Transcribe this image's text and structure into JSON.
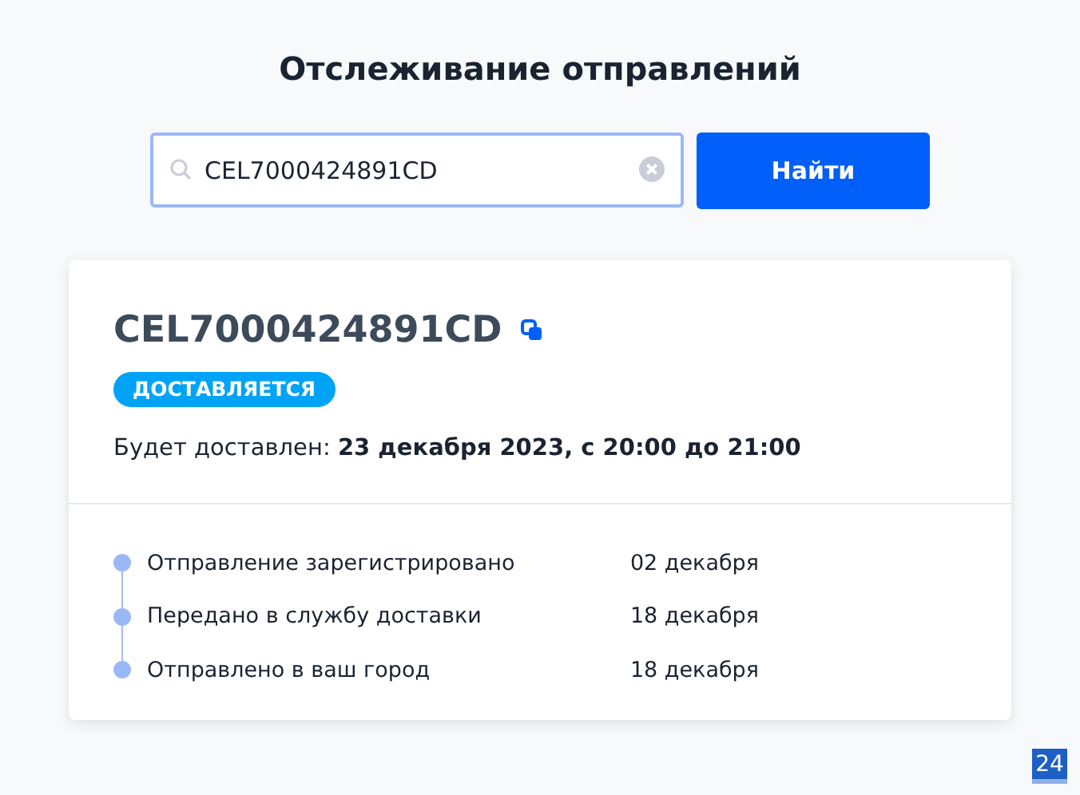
{
  "title": "Отслеживание отправлений",
  "search": {
    "value": "CEL7000424891CD"
  },
  "search_button": "Найти",
  "shipment": {
    "track_number": "CEL7000424891CD",
    "status": "ДОСТАВЛЯЕТСЯ",
    "delivery": "Будет доставлен: **23 декабря 2023, с 20:00 до 21:00**",
    "events": [
      {
        "label": "Отправление зарегистрировано",
        "date": "02 декабря"
      },
      {
        "label": "Передано в службу доставки",
        "date": "18 декабря"
      },
      {
        "label": "Отправлено в ваш город",
        "date": "18 декабря"
      }
    ]
  },
  "corner_badge": "24"
}
